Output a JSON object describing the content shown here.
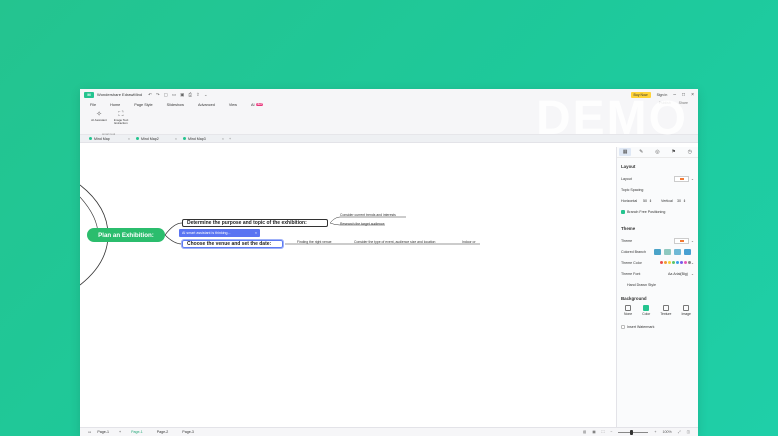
{
  "app": {
    "title": "Wondershare EdrawMind",
    "logo_text": "M",
    "buy_label": "Buy Now",
    "signin_label": "Sign in",
    "watermark": "DEMO"
  },
  "menu": {
    "items": [
      "File",
      "Home",
      "Page Style",
      "Slideshow",
      "Advanced",
      "View",
      "AI"
    ],
    "new_badge": "NEW",
    "publish": "Publish",
    "share": "Share"
  },
  "ribbon": {
    "ai_assistant": "AI Assistant",
    "image_text": "Image Text Extraction",
    "group_label": "smart tool"
  },
  "tabs": [
    {
      "label": "Mind Map"
    },
    {
      "label": "Mind Map2"
    },
    {
      "label": "Mind Map3"
    }
  ],
  "canvas": {
    "main_topic": "Plan an Exhibition:",
    "topic1": "Determine the purpose and topic of the exhibition:",
    "topic2": "Choose the venue and set the date:",
    "ai_status": "AI smart assistant is thinking...",
    "sub1": "Consider current trends and interests",
    "sub2": "Research the target audience",
    "sub3": "Finding the right venue",
    "sub4": "Consider the type of event, audience size and location",
    "sub5": "Indoor or"
  },
  "panel": {
    "layout_section": "Layout",
    "layout_label": "Layout",
    "topic_spacing": "Topic Spacing",
    "horizontal_label": "Horizontal",
    "horizontal_value": "50",
    "vertical_label": "Vertical",
    "vertical_value": "30",
    "branch_free": "Branch Free Positioning",
    "theme_section": "Theme",
    "theme_label": "Theme",
    "colored_branch": "Colored Branch",
    "theme_color": "Theme Color",
    "theme_font": "Theme Font",
    "theme_font_value": "Aa Arial(Big)",
    "hand_drawn": "Hand Drawn Style",
    "background_section": "Background",
    "bg_none": "None",
    "bg_color": "Color",
    "bg_texture": "Texture",
    "bg_image": "Image",
    "insert_watermark": "Insert Watermark"
  },
  "status": {
    "page_selector": "Page-1",
    "add": "+",
    "pages": [
      "Page-1",
      "Page-2",
      "Page-3"
    ],
    "zoom": "100%"
  },
  "colors": {
    "accent": "#24c48f",
    "main_topic": "#2bbd6d",
    "ai_bar": "#5a74f2"
  }
}
